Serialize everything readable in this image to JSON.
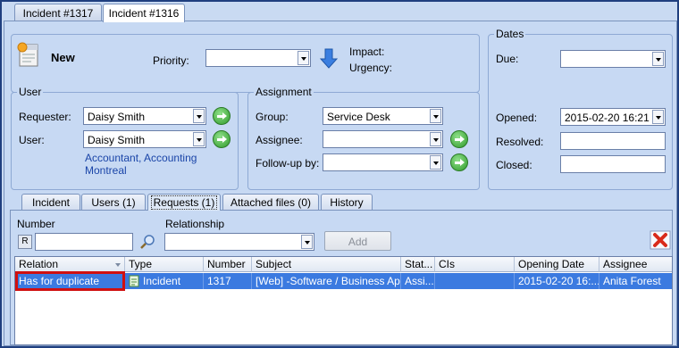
{
  "doc_tabs": [
    "Incident #1317",
    "Incident #1316"
  ],
  "header": {
    "title": "New",
    "priority_label": "Priority:",
    "priority_value": "",
    "impact_label": "Impact:",
    "urgency_label": "Urgency:"
  },
  "dates": {
    "group_label": "Dates",
    "due_label": "Due:",
    "due_value": "",
    "opened_label": "Opened:",
    "opened_value": "2015-02-20 16:21",
    "resolved_label": "Resolved:",
    "closed_label": "Closed:"
  },
  "user": {
    "group_label": "User",
    "requester_label": "Requester:",
    "requester_value": "Daisy Smith",
    "user_label": "User:",
    "user_value": "Daisy Smith",
    "link_line1": "Accountant, Accounting",
    "link_line2": "Montreal"
  },
  "assignment": {
    "group_label": "Assignment",
    "group_field_label": "Group:",
    "group_value": "Service Desk",
    "assignee_label": "Assignee:",
    "assignee_value": "",
    "followup_label": "Follow-up by:",
    "followup_value": ""
  },
  "lower_tabs": [
    "Incident",
    "Users (1)",
    "Requests (1)",
    "Attached files (0)",
    "History"
  ],
  "requests": {
    "number_label": "Number",
    "r_badge": "R",
    "relationship_label": "Relationship",
    "add_label": "Add"
  },
  "grid": {
    "columns": [
      "Relation",
      "Type",
      "Number",
      "Subject",
      "Stat...",
      "CIs",
      "Opening Date",
      "Assignee"
    ],
    "rows": [
      [
        "Has for duplicate",
        "Incident",
        "1317",
        "[Web] -Software / Business Ap...",
        "Assi...",
        "",
        "2015-02-20  16:...",
        "Anita Forest"
      ]
    ]
  },
  "colors": {
    "selection": "#3b7ae0",
    "highlight_box": "#d01010",
    "link": "#1a45a8"
  }
}
